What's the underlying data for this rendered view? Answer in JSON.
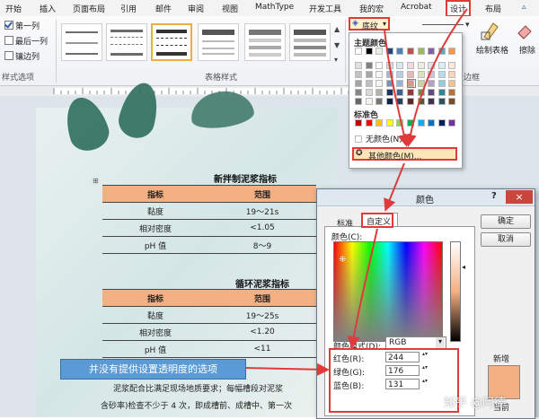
{
  "ribbon": {
    "tabs": [
      "开始",
      "插入",
      "页面布局",
      "引用",
      "邮件",
      "审阅",
      "视图",
      "MathType",
      "开发工具",
      "我的宏",
      "Acrobat",
      "设计",
      "布局"
    ],
    "active_tab": "设计",
    "options": [
      {
        "label": "第一列",
        "checked": true
      },
      {
        "label": "最后一列",
        "checked": false
      },
      {
        "label": "镶边列",
        "checked": false
      }
    ],
    "group_options_label": "样式选项",
    "group_styles_label": "表格样式",
    "group_borders_label": "边框",
    "shading_label": "底纹",
    "draw_table_label": "绘制表格",
    "eraser_label": "擦除"
  },
  "dropdown": {
    "theme_colors_label": "主题颜色",
    "standard_colors_label": "标准色",
    "no_color_label": "无颜色(N)",
    "more_colors_label": "其他颜色(M)...",
    "theme_top_row": [
      "#ffffff",
      "#000000",
      "#eeece1",
      "#1f497d",
      "#4f81bd",
      "#c0504d",
      "#9bbb59",
      "#8064a2",
      "#4bacc6",
      "#f79646"
    ],
    "standard_row": [
      "#c00000",
      "#ff0000",
      "#ffc000",
      "#ffff00",
      "#92d050",
      "#00b050",
      "#00b0f0",
      "#0070c0",
      "#002060",
      "#7030a0"
    ]
  },
  "document": {
    "table1_title": "新拌制泥浆指标",
    "table2_title": "循环泥浆指标",
    "headers": [
      "指标",
      "范围"
    ],
    "table1_rows": [
      [
        "黏度",
        "19～21s"
      ],
      [
        "相对密度",
        "<1.05"
      ],
      [
        "pH 值",
        "8～9"
      ]
    ],
    "table2_rows": [
      [
        "黏度",
        "19～25s"
      ],
      [
        "相对密度",
        "<1.20"
      ],
      [
        "pH 值",
        "<11"
      ]
    ],
    "para1": "泥浆配合比满足现场地质要求；每幅槽段对泥浆",
    "para2": "含砂率)检查不少于 4 次，即成槽前、成槽中、第一次"
  },
  "dialog": {
    "title": "颜色",
    "help": "?",
    "close": "×",
    "tab_standard": "标准",
    "tab_custom": "自定义",
    "colors_label": "颜色(C):",
    "model_label": "颜色模式(D):",
    "model_value": "RGB",
    "red_label": "红色(R):",
    "red_value": "244",
    "green_label": "绿色(G):",
    "green_value": "176",
    "blue_label": "蓝色(B):",
    "blue_value": "131",
    "ok_label": "确定",
    "cancel_label": "取消",
    "new_label": "新增",
    "current_label": "当前",
    "new_color": "#f4b083"
  },
  "annotation": {
    "callout": "并没有提供设置透明度的选项"
  },
  "watermark": "知乎 @阿德"
}
